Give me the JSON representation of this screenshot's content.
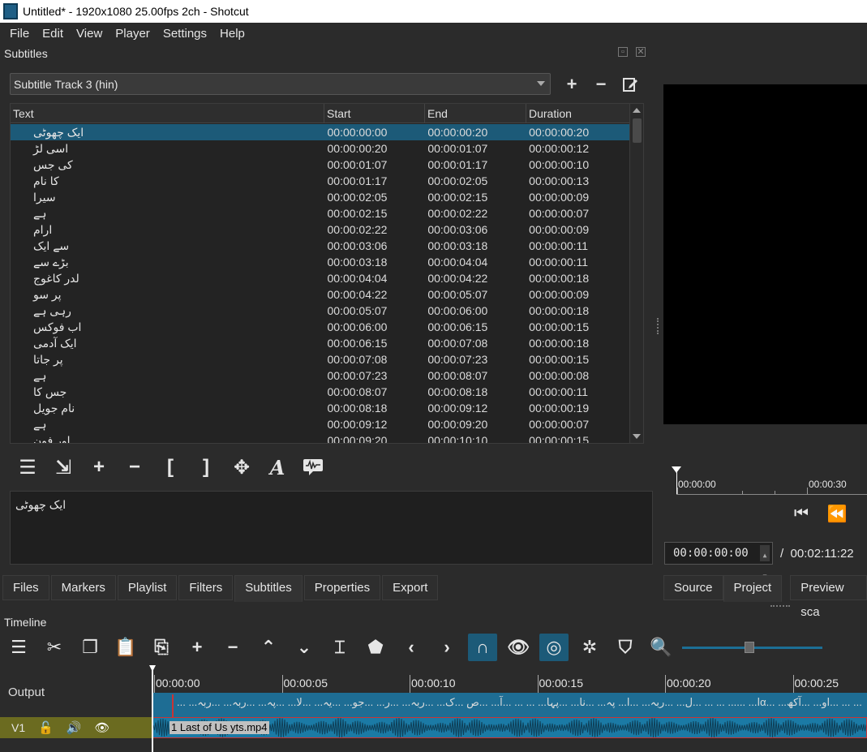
{
  "window": {
    "title": "Untitled* - 1920x1080 25.00fps 2ch - Shotcut"
  },
  "menu": [
    "File",
    "Edit",
    "View",
    "Player",
    "Settings",
    "Help"
  ],
  "subtitles_panel": {
    "title": "Subtitles",
    "track_select": "Subtitle Track 3 (hin)",
    "columns": [
      "Text",
      "Start",
      "End",
      "Duration"
    ],
    "rows": [
      {
        "text": "ایک چھوٹی",
        "start": "00:00:00:00",
        "end": "00:00:00:20",
        "duration": "00:00:00:20",
        "selected": true
      },
      {
        "text": "اسی لڑ",
        "start": "00:00:00:20",
        "end": "00:00:01:07",
        "duration": "00:00:00:12"
      },
      {
        "text": "کی جس",
        "start": "00:00:01:07",
        "end": "00:00:01:17",
        "duration": "00:00:00:10"
      },
      {
        "text": "کا نام",
        "start": "00:00:01:17",
        "end": "00:00:02:05",
        "duration": "00:00:00:13"
      },
      {
        "text": "سیرا",
        "start": "00:00:02:05",
        "end": "00:00:02:15",
        "duration": "00:00:00:09"
      },
      {
        "text": "ہے",
        "start": "00:00:02:15",
        "end": "00:00:02:22",
        "duration": "00:00:00:07"
      },
      {
        "text": "ارام",
        "start": "00:00:02:22",
        "end": "00:00:03:06",
        "duration": "00:00:00:09"
      },
      {
        "text": "سے ایک",
        "start": "00:00:03:06",
        "end": "00:00:03:18",
        "duration": "00:00:00:11"
      },
      {
        "text": "بڑے سے",
        "start": "00:00:03:18",
        "end": "00:00:04:04",
        "duration": "00:00:00:11"
      },
      {
        "text": "لدر کاغوج",
        "start": "00:00:04:04",
        "end": "00:00:04:22",
        "duration": "00:00:00:18"
      },
      {
        "text": "پر سو",
        "start": "00:00:04:22",
        "end": "00:00:05:07",
        "duration": "00:00:00:09"
      },
      {
        "text": "رہی ہے",
        "start": "00:00:05:07",
        "end": "00:00:06:00",
        "duration": "00:00:00:18"
      },
      {
        "text": "اب فوکس",
        "start": "00:00:06:00",
        "end": "00:00:06:15",
        "duration": "00:00:00:15"
      },
      {
        "text": "ایک آدمی",
        "start": "00:00:06:15",
        "end": "00:00:07:08",
        "duration": "00:00:00:18"
      },
      {
        "text": "پر جاتا",
        "start": "00:00:07:08",
        "end": "00:00:07:23",
        "duration": "00:00:00:15"
      },
      {
        "text": "ہے",
        "start": "00:00:07:23",
        "end": "00:00:08:07",
        "duration": "00:00:00:08"
      },
      {
        "text": "جس کا",
        "start": "00:00:08:07",
        "end": "00:00:08:18",
        "duration": "00:00:00:11"
      },
      {
        "text": "نام جویل",
        "start": "00:00:08:18",
        "end": "00:00:09:12",
        "duration": "00:00:00:19"
      },
      {
        "text": "ہے",
        "start": "00:00:09:12",
        "end": "00:00:09:20",
        "duration": "00:00:00:07"
      },
      {
        "text": "اور فون",
        "start": "00:00:09:20",
        "end": "00:00:10:10",
        "duration": "00:00:00:15"
      }
    ],
    "edit_text": "ایک چھوٹی"
  },
  "bottom_tabs": [
    "Files",
    "Markers",
    "Playlist",
    "Filters",
    "Subtitles",
    "Properties",
    "Export"
  ],
  "player": {
    "ruler_labels": [
      "00:00:00",
      "00:00:30"
    ],
    "timecode": "00:00:00:00",
    "separator": "/",
    "duration": "00:02:11:22",
    "tabs": [
      "Source",
      "Project",
      "Preview sca"
    ]
  },
  "timeline": {
    "title": "Timeline",
    "ruler_labels": [
      "00:00:00",
      "00:00:05",
      "00:00:10",
      "00:00:15",
      "00:00:20",
      "00:00:25"
    ],
    "output_label": "Output",
    "track_name": "V1",
    "subtitle_strip": "... ...ا... ...... ... ... ...ل... ...ربہ... ...ا... پہ... ...نا... ...پہا... ... ... ...آ... ...ص ...ک... ...ربہ... ...ر... ...جو... ...یہ... ...لا... ...پہ... ...ربہ... ...ربہα... ...او... ...آکھ... ... ...",
    "clip_label": "1 Last of Us yts.mp4"
  },
  "colors": {
    "accent": "#1c5a78",
    "track_clip": "#1b7aa5",
    "v1_header": "#6b6b20"
  }
}
